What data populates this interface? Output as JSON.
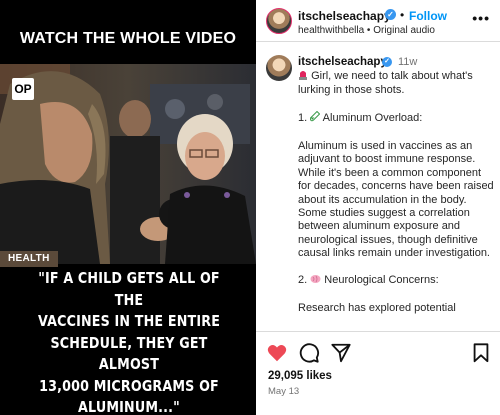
{
  "media": {
    "header_text": "WATCH THE WHOLE VIDEO",
    "logo_text": "OP",
    "category_tag": "HEALTH",
    "quote_lines": [
      "\"IF A CHILD GETS ALL OF THE",
      "VACCINES IN THE ENTIRE",
      "SCHEDULE, THEY GET ALMOST",
      "13,000 MICROGRAMS OF",
      "ALUMINUM...\""
    ]
  },
  "post_header": {
    "username": "itschelseachapy",
    "follow_label": "Follow",
    "separator": "•",
    "subline": "healthwithbella • Original audio",
    "more_label": "•••"
  },
  "caption": {
    "username": "itschelseachapy",
    "time": "11w",
    "line1": "Girl, we need to talk about what's lurking in those shots.",
    "section1_title": "1. Aluminum Overload:",
    "section1_body": "Aluminum is used in vaccines as an adjuvant to boost immune response. While it's been a common component for decades, concerns have been raised about its accumulation in the body. Some studies suggest a correlation between aluminum exposure and neurological issues, though definitive causal links remain under investigation.",
    "section2_title": "2. Neurological Concerns:",
    "section3_body": "Research has explored potential"
  },
  "footer": {
    "likes": "29,095 likes",
    "date": "May 13"
  },
  "icons": {
    "heart": "heart-icon",
    "comment": "comment-icon",
    "share": "share-icon",
    "save": "bookmark-icon",
    "verified": "verified-badge-icon",
    "siren": "siren-icon",
    "test_tube": "test-tube-icon",
    "brain": "brain-icon"
  },
  "colors": {
    "follow": "#0095f6",
    "heart": "#ed4956",
    "verified": "#3897f0"
  }
}
